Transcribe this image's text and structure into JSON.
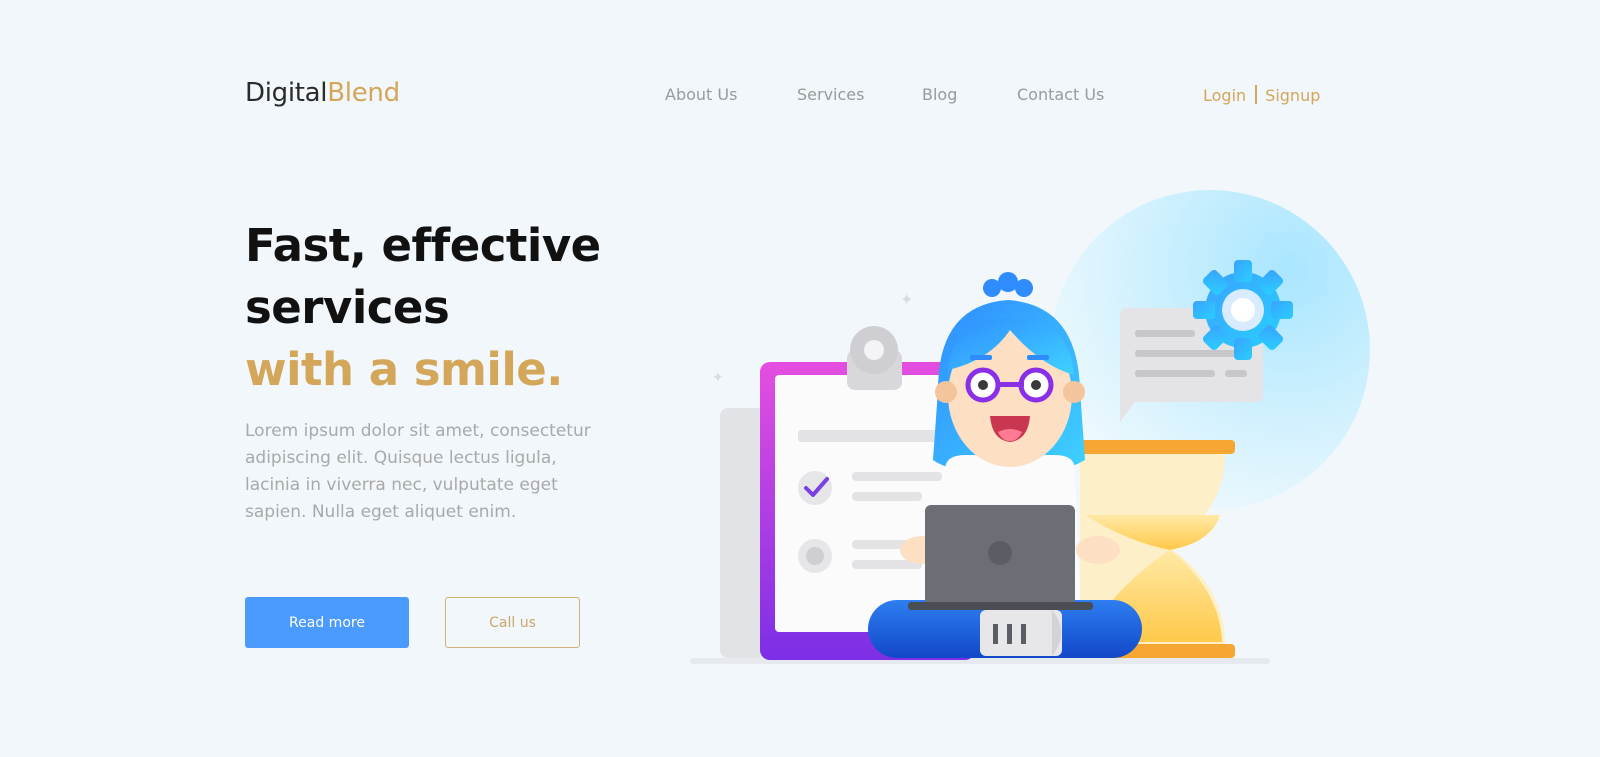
{
  "brand": {
    "name_part1": "Digital",
    "name_part2": "Blend"
  },
  "nav": {
    "items": [
      {
        "label": "About Us"
      },
      {
        "label": "Services"
      },
      {
        "label": "Blog"
      },
      {
        "label": "Contact Us"
      }
    ],
    "login_label": "Login",
    "signup_label": "Signup"
  },
  "hero": {
    "title_line1": "Fast, effective",
    "title_line2": "services",
    "title_line3": "with a smile.",
    "description": "Lorem ipsum dolor sit amet, consectetur adipiscing elit. Quisque lectus ligula, lacinia in viverra nec, vulputate eget sapien. Nulla eget aliquet enim.",
    "primary_button": "Read more",
    "secondary_button": "Call us"
  },
  "colors": {
    "background": "#f1f7fb",
    "accent_gold": "#d3a65a",
    "primary_blue": "#4b9bff",
    "heading": "#111111",
    "muted_text": "#a9a9a9"
  },
  "illustration": {
    "icons": [
      "clipboard-icon",
      "checkmark-icon",
      "gear-icon",
      "chat-bubble-icon",
      "hourglass-icon",
      "laptop-icon",
      "person-avatar-icon"
    ]
  }
}
